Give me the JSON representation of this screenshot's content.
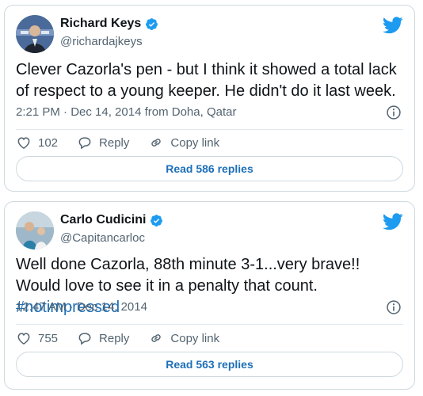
{
  "colors": {
    "twitter_blue": "#1d9bf0",
    "link_blue": "#1d6fb8",
    "text_primary": "#0f1419",
    "text_secondary": "#536471",
    "border": "#cfd9de"
  },
  "tweets": [
    {
      "display_name": "Richard Keys",
      "handle": "@richardajkeys",
      "verified": true,
      "text": "Clever Cazorla's pen - but I think it showed a total lack of respect to a young keeper. He didn't do it last week.",
      "timestamp": "2:21 PM · Dec 14, 2014 from Doha, Qatar",
      "like_count": "102",
      "reply_label": "Reply",
      "copy_link_label": "Copy link",
      "read_replies_label": "Read 586 replies"
    },
    {
      "display_name": "Carlo Cudicini",
      "handle": "@Capitancarloc",
      "verified": true,
      "text": "Well done Cazorla, 88th minute 3-1...very brave!! Would love to see it in a penalty that count. ",
      "hashtag": "#notimpressed",
      "timestamp": "12:47 AM · Dec 14, 2014",
      "like_count": "755",
      "reply_label": "Reply",
      "copy_link_label": "Copy link",
      "read_replies_label": "Read 563 replies"
    }
  ],
  "icons": {
    "verified": "verified-badge-icon",
    "brand": "twitter-bird-icon",
    "info": "info-icon",
    "like": "heart-icon",
    "reply": "speech-bubble-icon",
    "copy_link": "chain-link-icon"
  }
}
